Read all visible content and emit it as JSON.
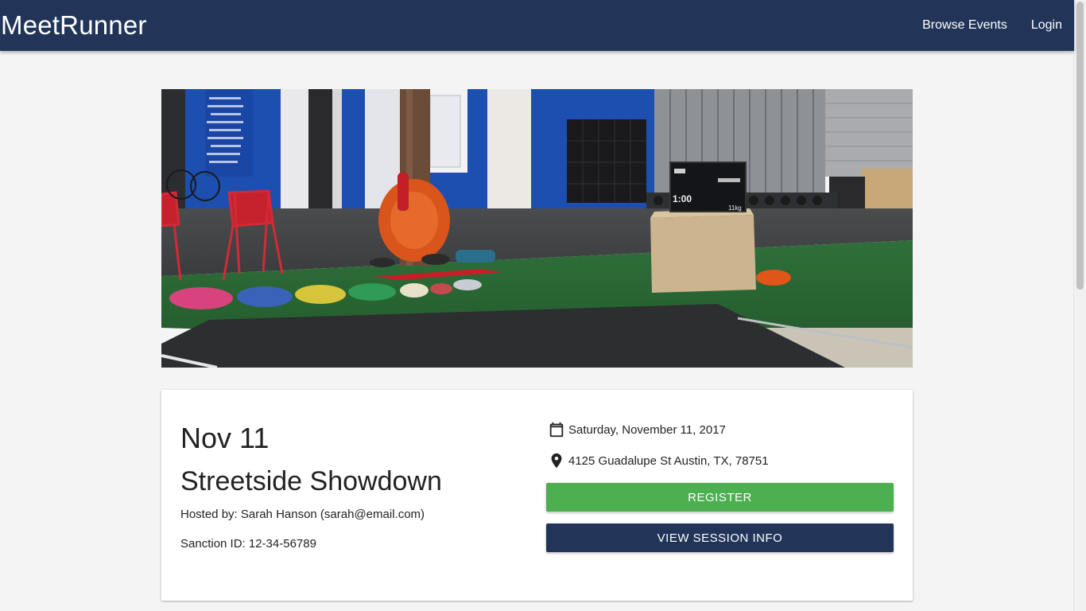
{
  "nav": {
    "brand": "MeetRunner",
    "links": [
      "Browse Events",
      "Login"
    ]
  },
  "event": {
    "date_short": "Nov 11",
    "title": "Streetside Showdown",
    "hosted_by": "Hosted by: Sarah Hanson (sarah@email.com)",
    "sanction": "Sanction ID: 12-34-56789",
    "date_full": "Saturday, November 11, 2017",
    "address": "4125 Guadalupe St Austin, TX, 78751",
    "register_label": "REGISTER",
    "session_label": "VIEW SESSION INFO"
  },
  "hero": {
    "timer": "1:00",
    "weight": "11kg"
  },
  "icons": {
    "calendar": "calendar-icon",
    "location": "location-pin-icon"
  },
  "colors": {
    "navbar": "#223559",
    "register": "#4caf50",
    "session": "#223559",
    "background": "#f4f4f4"
  }
}
